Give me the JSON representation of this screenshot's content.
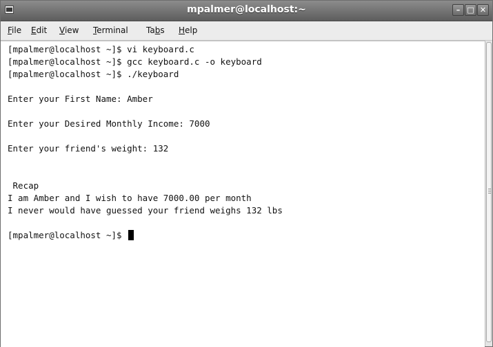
{
  "window": {
    "title": "mpalmer@localhost:~",
    "minimize_glyph": "–",
    "maximize_glyph": "□",
    "close_glyph": "✕"
  },
  "menubar": {
    "items": [
      {
        "first": "F",
        "rest": "ile"
      },
      {
        "first": "E",
        "rest": "dit"
      },
      {
        "first": "V",
        "rest": "iew"
      },
      {
        "first": "T",
        "rest": "erminal"
      },
      {
        "pre": "Ta",
        "first": "b",
        "rest": "s"
      },
      {
        "first": "H",
        "rest": "elp"
      }
    ]
  },
  "terminal": {
    "lines": [
      "[mpalmer@localhost ~]$ vi keyboard.c",
      "[mpalmer@localhost ~]$ gcc keyboard.c -o keyboard",
      "[mpalmer@localhost ~]$ ./keyboard",
      "Enter your First Name: Amber",
      "Enter your Desired Monthly Income: 7000",
      "Enter your friend's weight: 132",
      " Recap",
      "I am Amber and I wish to have 7000.00 per month",
      "I never would have guessed your friend weighs 132 lbs",
      "[mpalmer@localhost ~]$ "
    ]
  },
  "colors": {
    "titlebar": "#6f6f6f",
    "terminal_bg": "#ffffff",
    "text": "#111111"
  }
}
